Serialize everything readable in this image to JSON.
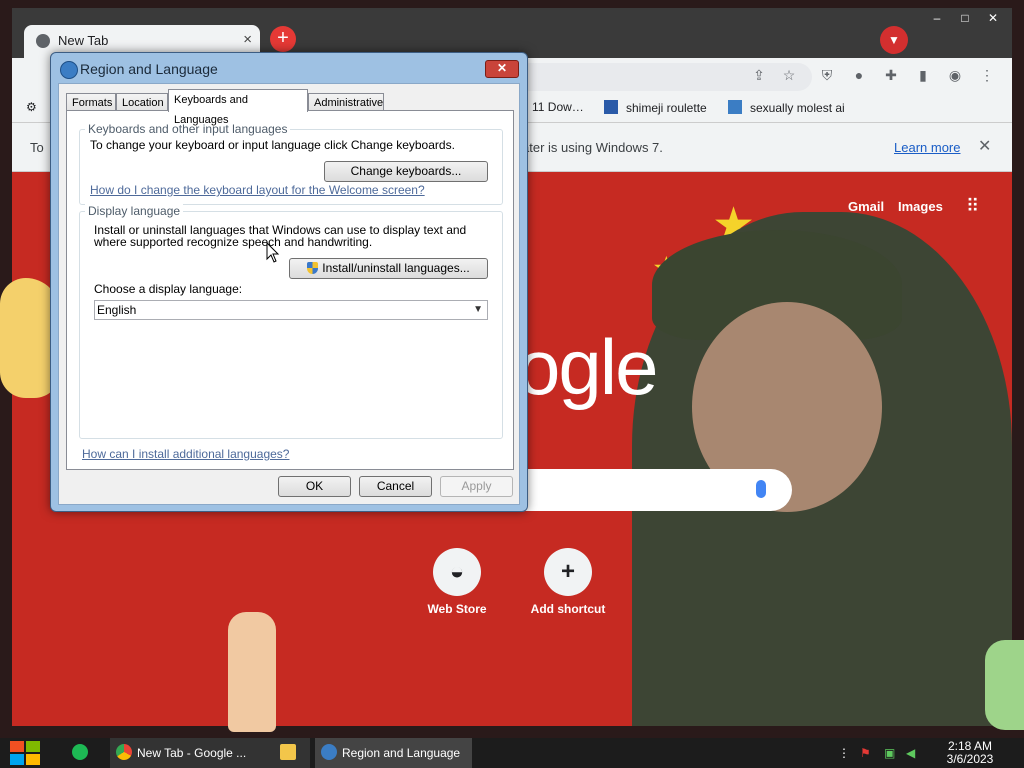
{
  "browser": {
    "tab_title": "New Tab",
    "tab_close": "×",
    "new_tab": "+",
    "window_controls": [
      "–",
      "□",
      "✕"
    ],
    "bookmarks": [
      {
        "label": "11 Dow…"
      },
      {
        "label": "shimeji roulette"
      },
      {
        "label": "sexually molest ai"
      }
    ],
    "infobar": {
      "text_left": "To",
      "text_right": "ater is using Windows 7.",
      "learn_more": "Learn more",
      "close": "✕"
    }
  },
  "ntp": {
    "gmail": "Gmail",
    "images": "Images",
    "logo_fragment": "ogle",
    "shortcuts": [
      {
        "label": "Web Store"
      },
      {
        "label": "Add shortcut",
        "icon": "+"
      }
    ]
  },
  "dialog": {
    "title": "Region and Language",
    "close": "✕",
    "tabs": [
      "Formats",
      "Location",
      "Keyboards and Languages",
      "Administrative"
    ],
    "active_tab": "Keyboards and Languages",
    "keyboards_group": {
      "label": "Keyboards and other input languages",
      "text": "To change your keyboard or input language click Change keyboards.",
      "button": "Change keyboards...",
      "link": "How do I change the keyboard layout for the Welcome screen?"
    },
    "display_group": {
      "label": "Display language",
      "text_line1": "Install or uninstall languages that Windows can use to display text and",
      "text_line2": "where supported recognize speech and handwriting.",
      "button": "Install/uninstall languages...",
      "choose_label": "Choose a display language:",
      "selected_language": "English"
    },
    "bottom_link": "How can I install additional languages?",
    "buttons": {
      "ok": "OK",
      "cancel": "Cancel",
      "apply": "Apply"
    }
  },
  "taskbar": {
    "items": [
      {
        "label": "New Tab - Google ..."
      },
      {
        "label": "Region and Language"
      }
    ],
    "time": "2:18 AM",
    "date": "3/6/2023"
  },
  "colors": {
    "ntp_background": "#c62a22",
    "link": "#4e6a9a",
    "learn_more": "#1a5dc6"
  }
}
